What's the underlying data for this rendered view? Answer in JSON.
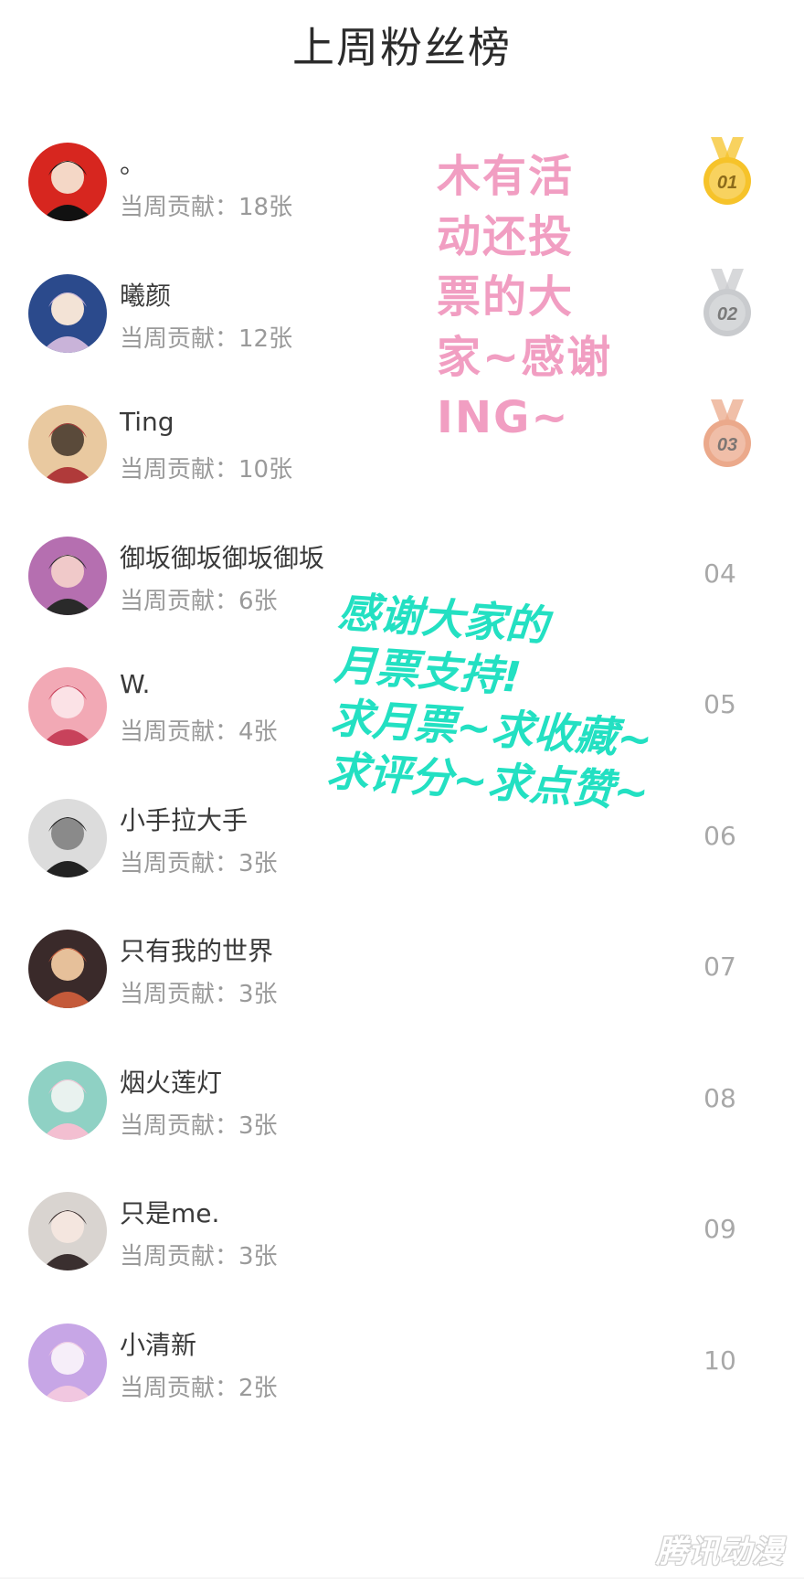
{
  "page_title": "上周粉丝榜",
  "contribution_prefix": "当周贡献：",
  "fans": [
    {
      "rank": "01",
      "name": "。",
      "contribution": "当周贡献：18张",
      "medal": "gold"
    },
    {
      "rank": "02",
      "name": "曦颜",
      "contribution": "当周贡献：12张",
      "medal": "silver"
    },
    {
      "rank": "03",
      "name": "Ting",
      "contribution": "当周贡献：10张",
      "medal": "bronze"
    },
    {
      "rank": "04",
      "name": "御坂御坂御坂御坂",
      "contribution": "当周贡献：6张",
      "medal": ""
    },
    {
      "rank": "05",
      "name": "W.",
      "contribution": "当周贡献：4张",
      "medal": ""
    },
    {
      "rank": "06",
      "name": " 小手拉大手",
      "contribution": "当周贡献：3张",
      "medal": ""
    },
    {
      "rank": "07",
      "name": "只有我的世界",
      "contribution": "当周贡献：3张",
      "medal": ""
    },
    {
      "rank": "08",
      "name": "烟火莲灯",
      "contribution": "当周贡献：3张",
      "medal": ""
    },
    {
      "rank": "09",
      "name": "只是me.",
      "contribution": "当周贡献：3张",
      "medal": ""
    },
    {
      "rank": "10",
      "name": "小清新",
      "contribution": "当周贡献：2张",
      "medal": ""
    }
  ],
  "overlay_pink": [
    "木有活",
    "动还投",
    "票的大",
    "家~感谢",
    "ING~"
  ],
  "overlay_cyan": [
    "感谢大家的",
    "月票支持!",
    "求月票~求收藏~",
    "求评分~求点赞~"
  ],
  "watermark": "腾讯动漫",
  "colors": {
    "gold": "#f6c32a",
    "silver": "#c9cbce",
    "bronze": "#eba98b",
    "pink_text": "#f19ec2",
    "cyan_text": "#23e0c2"
  }
}
